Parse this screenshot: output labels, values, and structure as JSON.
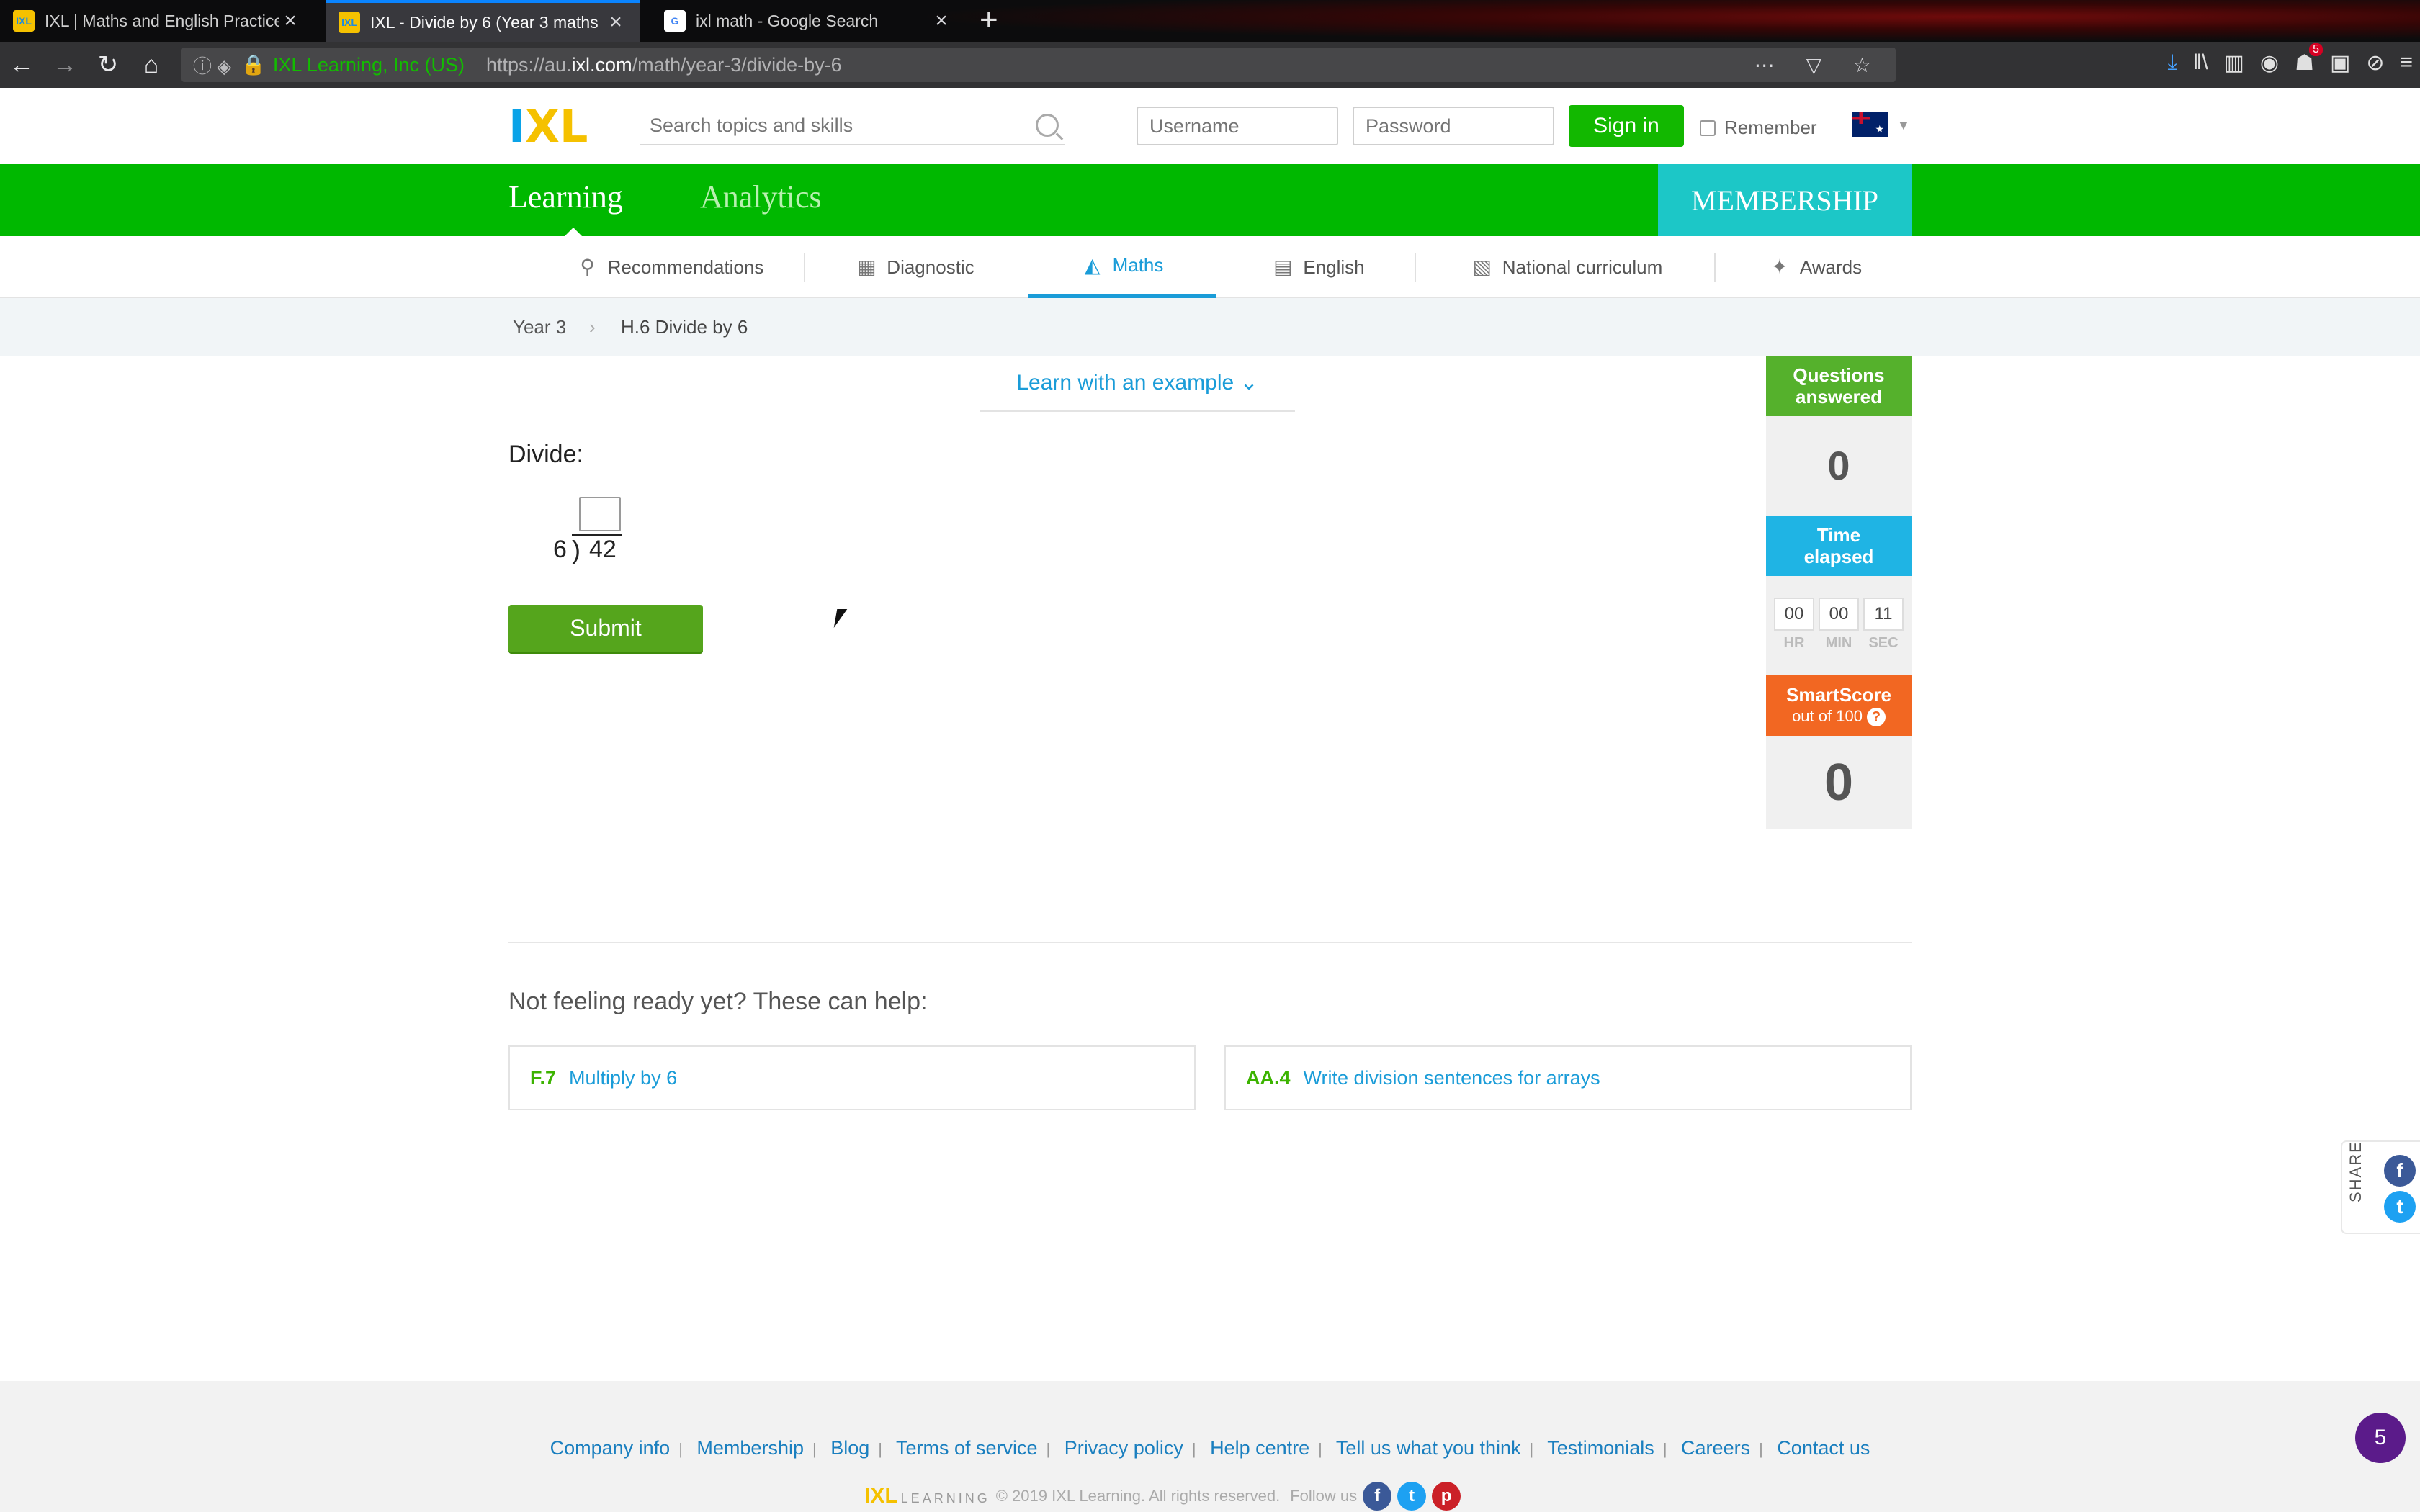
{
  "browser": {
    "tabs": [
      {
        "title": "IXL | Maths and English Practice",
        "favicon": "ixl-icon",
        "active": false
      },
      {
        "title": "IXL - Divide by 6 (Year 3 maths",
        "favicon": "ixl-icon",
        "active": true
      },
      {
        "title": "ixl math - Google Search",
        "favicon": "google-icon",
        "active": false
      }
    ],
    "site_identity": "IXL Learning, Inc (US)",
    "url_prefix": "https://au.",
    "url_domain": "ixl.com",
    "url_path": "/math/year-3/divide-by-6",
    "notification_count": "5"
  },
  "header": {
    "search_placeholder": "Search topics and skills",
    "username_placeholder": "Username",
    "password_placeholder": "Password",
    "signin_label": "Sign in",
    "remember_label": "Remember"
  },
  "main_nav": {
    "learning": "Learning",
    "analytics": "Analytics",
    "membership": "MEMBERSHIP"
  },
  "sub_nav": [
    {
      "label": "Recommendations",
      "icon": "recommendations-icon"
    },
    {
      "label": "Diagnostic",
      "icon": "diagnostic-icon"
    },
    {
      "label": "Maths",
      "icon": "maths-icon",
      "active": true
    },
    {
      "label": "English",
      "icon": "english-icon"
    },
    {
      "label": "National curriculum",
      "icon": "curriculum-icon"
    },
    {
      "label": "Awards",
      "icon": "awards-icon"
    }
  ],
  "breadcrumb": {
    "level": "Year 3",
    "skill": "H.6 Divide by 6"
  },
  "question": {
    "learn_example": "Learn with an example",
    "prompt": "Divide:",
    "divisor": "6",
    "dividend": "42",
    "submit_label": "Submit"
  },
  "stats": {
    "questions_answered_label": "Questions answered",
    "questions_answered": "0",
    "time_elapsed_label": "Time elapsed",
    "time": {
      "hr": "00",
      "min": "00",
      "sec": "11"
    },
    "time_units": {
      "hr": "HR",
      "min": "MIN",
      "sec": "SEC"
    },
    "smartscore_label": "SmartScore",
    "smartscore_sub": "out of 100",
    "smartscore": "0"
  },
  "help": {
    "title": "Not feeling ready yet? These can help:",
    "cards": [
      {
        "code": "F.7",
        "name": "Multiply by 6"
      },
      {
        "code": "AA.4",
        "name": "Write division sentences for arrays"
      }
    ]
  },
  "share": {
    "label": "SHARE"
  },
  "footer": {
    "links": [
      "Company info",
      "Membership",
      "Blog",
      "Terms of service",
      "Privacy policy",
      "Help centre",
      "Tell us what you think",
      "Testimonials",
      "Careers",
      "Contact us"
    ],
    "copyright": "© 2019 IXL Learning. All rights reserved.",
    "follow": "Follow us"
  },
  "chat_badge": "5",
  "colors": {
    "brand_green": "#00b800",
    "membership_teal": "#1cc7c7",
    "link_blue": "#1a9cd8",
    "submit_green": "#55a51c",
    "smartscore_orange": "#f26722"
  }
}
